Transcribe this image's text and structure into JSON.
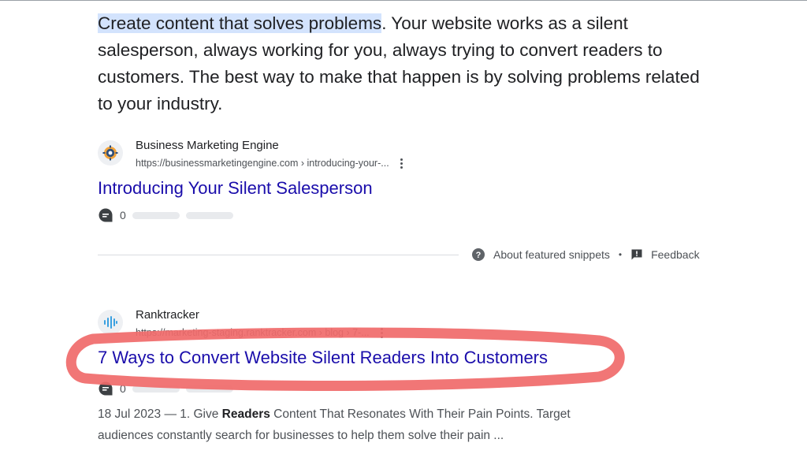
{
  "featured_snippet": {
    "highlighted_text": "Create content that solves problems",
    "rest_text": ". Your website works as a silent salesperson, always working for you, always trying to convert readers to customers. The best way to make that happen is by solving problems related to your industry."
  },
  "result1": {
    "site_name": "Business Marketing Engine",
    "url": "https://businessmarketingengine.com › introducing-your-...",
    "title": "Introducing Your Silent Salesperson",
    "comment_count": "0"
  },
  "footer": {
    "about_label": "About featured snippets",
    "separator": "•",
    "feedback_label": "Feedback"
  },
  "result2": {
    "site_name": "Ranktracker",
    "url": "https://marketing-staging.ranktracker.com › blog › 7-...",
    "title": "7 Ways to Convert Website Silent Readers Into Customers",
    "comment_count": "0",
    "snippet_prefix": "18 Jul 2023 — 1. Give ",
    "snippet_bold": "Readers",
    "snippet_rest": " Content That Resonates With Their Pain Points. Target audiences constantly search for businesses to help them solve their pain ..."
  },
  "colors": {
    "link": "#1a0dab",
    "highlight": "#d3e3fd",
    "annotation": "#f06a6a"
  }
}
